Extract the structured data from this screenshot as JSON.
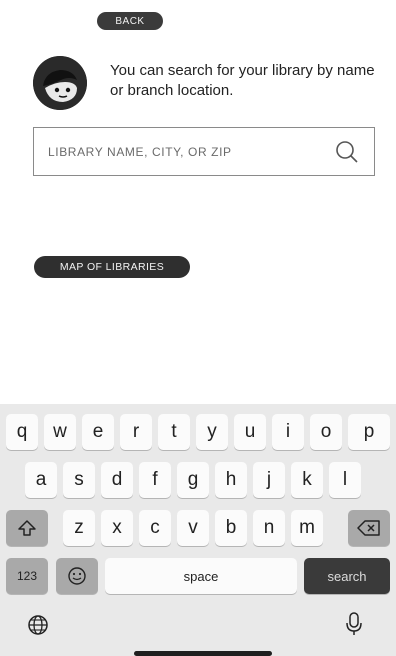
{
  "header": {
    "back_label": "BACK"
  },
  "intro": {
    "text": "You can search for your library by name or branch location."
  },
  "search": {
    "placeholder": "LIBRARY NAME, CITY, OR ZIP",
    "value": ""
  },
  "map_button": {
    "label": "MAP OF LIBRARIES"
  },
  "keyboard": {
    "row1": [
      "q",
      "w",
      "e",
      "r",
      "t",
      "y",
      "u",
      "i",
      "o",
      "p"
    ],
    "row2": [
      "a",
      "s",
      "d",
      "f",
      "g",
      "h",
      "j",
      "k",
      "l"
    ],
    "row3": [
      "z",
      "x",
      "c",
      "v",
      "b",
      "n",
      "m"
    ],
    "numbers_label": "123",
    "space_label": "space",
    "search_label": "search",
    "icons": {
      "shift": "shift-icon",
      "delete": "delete-icon",
      "emoji": "emoji-icon",
      "globe": "globe-icon",
      "mic": "microphone-icon"
    }
  },
  "colors": {
    "button_dark": "#2f2f2f",
    "keyboard_bg": "#e9e9e9",
    "key_bg": "#fbfbfb",
    "key_dark": "#a9a9a9"
  }
}
